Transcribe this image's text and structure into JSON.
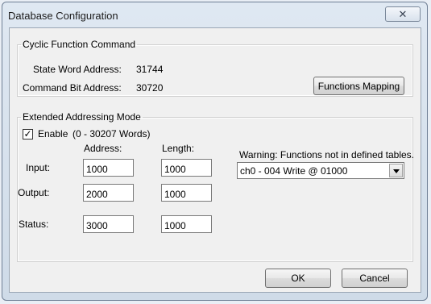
{
  "window": {
    "title": "Database Configuration",
    "close_glyph": "✕"
  },
  "cyclic": {
    "legend": "Cyclic Function Command",
    "state_word_label": "State Word Address:",
    "state_word_value": "31744",
    "command_bit_label": "Command Bit Address:",
    "command_bit_value": "30720",
    "functions_mapping_button": "Functions Mapping"
  },
  "extended": {
    "legend": "Extended Addressing Mode",
    "enable_checked": true,
    "check_glyph": "✓",
    "enable_label": "Enable",
    "enable_range": "(0 - 30207 Words)",
    "address_header": "Address:",
    "length_header": "Length:",
    "rows": [
      {
        "label": "Input:",
        "address": "1000",
        "length": "1000"
      },
      {
        "label": "Output:",
        "address": "2000",
        "length": "1000"
      },
      {
        "label": "Status:",
        "address": "3000",
        "length": "1000"
      }
    ],
    "warning": "Warning: Functions not in defined tables.",
    "function_select": "ch0 - 004 Write @ 01000"
  },
  "buttons": {
    "ok": "OK",
    "cancel": "Cancel"
  }
}
